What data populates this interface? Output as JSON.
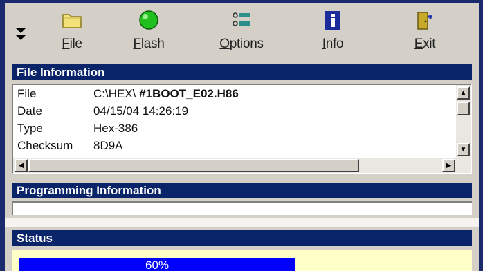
{
  "toolbar": {
    "buttons": [
      {
        "label": "File",
        "icon": "folder-icon"
      },
      {
        "label": "Flash",
        "icon": "green-light-icon"
      },
      {
        "label": "Options",
        "icon": "options-list-icon"
      },
      {
        "label": "Info",
        "icon": "info-icon"
      },
      {
        "label": "Exit",
        "icon": "exit-door-icon"
      }
    ]
  },
  "file_info": {
    "title": "File Information",
    "rows": [
      {
        "label": "File",
        "value_prefix": "C:\\HEX\\",
        "value_bold": "#1BOOT_E02.H86"
      },
      {
        "label": "Date",
        "value": "04/15/04 14:26:19"
      },
      {
        "label": "Type",
        "value": "Hex-386"
      },
      {
        "label": "Checksum",
        "value": "8D9A"
      }
    ]
  },
  "programming": {
    "title": "Programming Information"
  },
  "status": {
    "title": "Status",
    "progress_text": "60%",
    "progress_fraction": 0.6
  },
  "colors": {
    "header_bg": "#0a246a",
    "status_bg": "#ffffc8",
    "progress": "#0000ff"
  }
}
